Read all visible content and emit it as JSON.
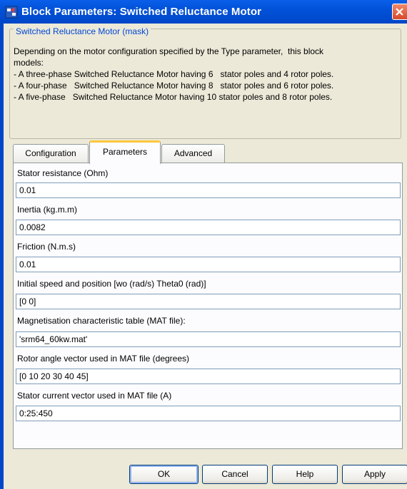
{
  "window": {
    "title": "Block Parameters: Switched Reluctance Motor"
  },
  "mask": {
    "title": "Switched Reluctance Motor (mask)",
    "description": [
      "Depending on the motor configuration specified by the Type parameter,  this block",
      "models:",
      "- A three-phase Switched Reluctance Motor having 6   stator poles and 4 rotor poles.",
      "- A four-phase   Switched Reluctance Motor having 8   stator poles and 6 rotor poles.",
      "- A five-phase   Switched Reluctance Motor having 10 stator poles and 8 rotor poles."
    ]
  },
  "tabs": [
    {
      "label": "Configuration",
      "active": false
    },
    {
      "label": "Parameters",
      "active": true
    },
    {
      "label": "Advanced",
      "active": false
    }
  ],
  "params": [
    {
      "label": "Stator resistance (Ohm)",
      "value": "0.01"
    },
    {
      "label": "Inertia (kg.m.m)",
      "value": "0.0082"
    },
    {
      "label": "Friction (N.m.s)",
      "value": "0.01"
    },
    {
      "label": "Initial speed and position [wo (rad/s) Theta0 (rad)]",
      "value": "[0 0]"
    },
    {
      "label": "Magnetisation characteristic table (MAT file):",
      "value": "'srm64_60kw.mat'"
    },
    {
      "label": "Rotor angle vector used in MAT file (degrees)",
      "value": "[0 10 20 30 40 45]"
    },
    {
      "label": "Stator current vector used in MAT file (A)",
      "value": "0:25:450"
    }
  ],
  "buttons": {
    "ok": "OK",
    "cancel": "Cancel",
    "help": "Help",
    "apply": "Apply"
  },
  "colors": {
    "title_bar": "#0152d8",
    "mask_title": "#0046d5",
    "active_tab_highlight": "#ffc83c"
  }
}
